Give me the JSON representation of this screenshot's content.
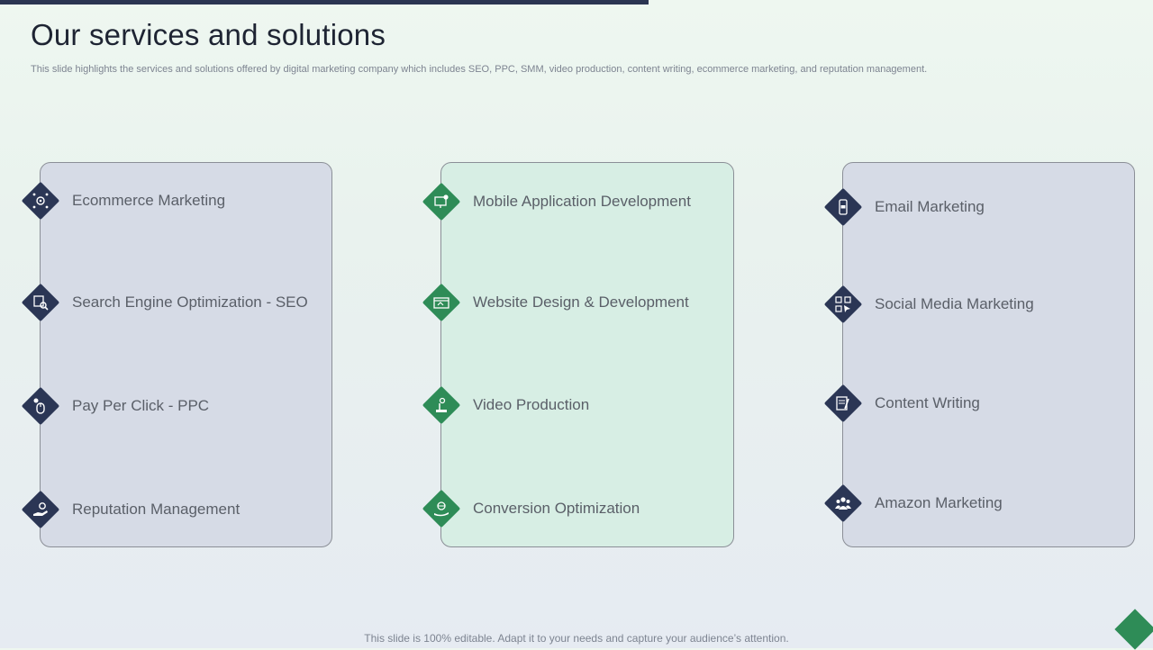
{
  "slide": {
    "title": "Our services and solutions",
    "subtitle": "This slide highlights the services and solutions offered by digital marketing company which includes SEO, PPC, SMM,  video production, content writing, ecommerce marketing, and reputation management.",
    "footer": "This slide is 100% editable. Adapt it to your needs and capture your audience’s attention."
  },
  "colors": {
    "navy": "#2b3655",
    "green": "#2e8c57",
    "panel_blue": "#d6dbe6",
    "panel_green": "#d7eee4"
  },
  "columns": [
    {
      "items": [
        {
          "label": "Ecommerce Marketing",
          "icon": "gear-network-icon"
        },
        {
          "label": "Search Engine Optimization - SEO",
          "icon": "search-documents-icon"
        },
        {
          "label": "Pay Per Click - PPC",
          "icon": "mouse-dollar-icon"
        },
        {
          "label": "Reputation Management",
          "icon": "hand-gear-icon"
        }
      ]
    },
    {
      "items": [
        {
          "label": "Mobile Application Development",
          "icon": "monitor-gear-icon"
        },
        {
          "label": "Website Design & Development",
          "icon": "browser-window-icon"
        },
        {
          "label": "Video Production",
          "icon": "film-camera-icon"
        },
        {
          "label": "Conversion Optimization",
          "icon": "hand-globe-icon"
        }
      ]
    },
    {
      "items": [
        {
          "label": "Email Marketing",
          "icon": "phone-mail-icon"
        },
        {
          "label": "Social Media Marketing",
          "icon": "social-share-icon"
        },
        {
          "label": "Content Writing",
          "icon": "document-pen-icon"
        },
        {
          "label": "Amazon Marketing",
          "icon": "team-icon"
        }
      ]
    }
  ]
}
